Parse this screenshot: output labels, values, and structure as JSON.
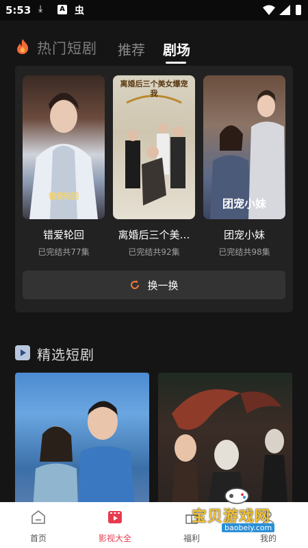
{
  "status_bar": {
    "time": "5:53"
  },
  "header": {
    "title": "热门短剧",
    "tabs": [
      "推荐",
      "剧场"
    ],
    "active_tab": "剧场"
  },
  "cards": [
    {
      "title": "错爱轮回",
      "subtitle": "已完结共77集",
      "poster_caption": "错爱轮回"
    },
    {
      "title": "离婚后三个美…",
      "subtitle": "已完结共92集",
      "poster_caption": "离婚后三个美女爆宠我"
    },
    {
      "title": "团宠小妹",
      "subtitle": "已完结共98集",
      "poster_caption": "团宠小妹"
    }
  ],
  "swap_button": {
    "label": "换一换"
  },
  "section2": {
    "title": "精选短剧"
  },
  "bottom_nav": [
    {
      "label": "首页",
      "icon": "home-icon"
    },
    {
      "label": "影视大全",
      "icon": "video-icon",
      "active": true
    },
    {
      "label": "福利",
      "icon": "gift-icon"
    },
    {
      "label": "我的",
      "icon": "user-icon"
    }
  ],
  "watermark": {
    "text": "宝贝游戏网",
    "url": "baobeiy.com"
  },
  "colors": {
    "accent": "#e93a4d",
    "panel": "#222222",
    "background": "#151515"
  }
}
